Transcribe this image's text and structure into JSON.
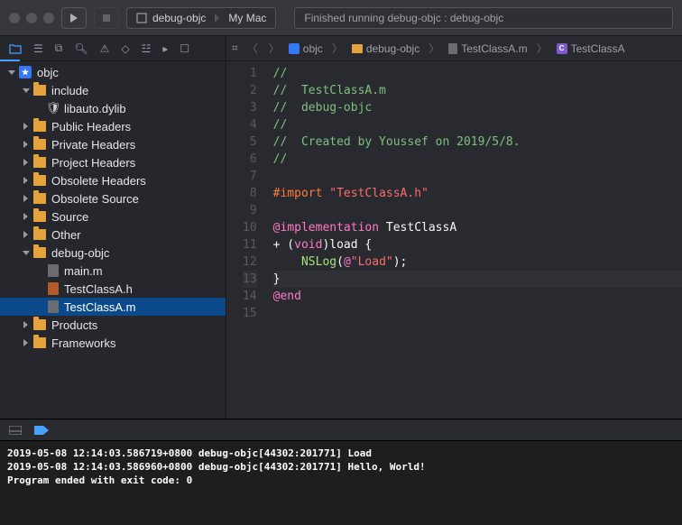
{
  "titlebar": {
    "scheme": "debug-objc",
    "destination": "My Mac",
    "activity": "Finished running debug-objc : debug-objc"
  },
  "navigator": {
    "project": "objc",
    "groups": [
      {
        "label": "include",
        "depth": 1,
        "open": true,
        "children": [
          {
            "label": "libauto.dylib",
            "type": "shield"
          }
        ]
      },
      {
        "label": "Public Headers",
        "depth": 1,
        "open": false
      },
      {
        "label": "Private Headers",
        "depth": 1,
        "open": false
      },
      {
        "label": "Project Headers",
        "depth": 1,
        "open": false
      },
      {
        "label": "Obsolete Headers",
        "depth": 1,
        "open": false
      },
      {
        "label": "Obsolete Source",
        "depth": 1,
        "open": false
      },
      {
        "label": "Source",
        "depth": 1,
        "open": false
      },
      {
        "label": "Other",
        "depth": 1,
        "open": false
      },
      {
        "label": "debug-objc",
        "depth": 1,
        "open": true,
        "children": [
          {
            "label": "main.m",
            "type": "m"
          },
          {
            "label": "TestClassA.h",
            "type": "h"
          },
          {
            "label": "TestClassA.m",
            "type": "m",
            "selected": true
          }
        ]
      },
      {
        "label": "Products",
        "depth": 1,
        "open": false
      },
      {
        "label": "Frameworks",
        "depth": 1,
        "open": false
      }
    ]
  },
  "jumpbar": {
    "crumbs": [
      "objc",
      "debug-objc",
      "TestClassA.m",
      "TestClassA"
    ]
  },
  "source": {
    "lines": [
      {
        "n": 1,
        "t": "//",
        "cls": "c-comment"
      },
      {
        "n": 2,
        "t": "//  TestClassA.m",
        "cls": "c-comment"
      },
      {
        "n": 3,
        "t": "//  debug-objc",
        "cls": "c-comment"
      },
      {
        "n": 4,
        "t": "//",
        "cls": "c-comment"
      },
      {
        "n": 5,
        "t": "//  Created by Youssef on 2019/5/8.",
        "cls": "c-comment"
      },
      {
        "n": 6,
        "t": "//",
        "cls": "c-comment"
      },
      {
        "n": 7,
        "t": "",
        "cls": ""
      },
      {
        "n": 8,
        "html": "<span class='c-pre'>#import </span><span class='c-str'>\"TestClassA.h\"</span>"
      },
      {
        "n": 9,
        "t": "",
        "cls": ""
      },
      {
        "n": 10,
        "html": "<span class='c-key'>@implementation</span> <span class='c-ident'>TestClassA</span>"
      },
      {
        "n": 11,
        "html": "<span class='c-ident'>+ (</span><span class='c-key'>void</span><span class='c-ident'>)load {</span>"
      },
      {
        "n": 12,
        "html": "    <span class='c-func'>NSLog</span><span class='c-ident'>(</span><span class='c-at'>@</span><span class='c-str'>\"Load\"</span><span class='c-ident'>);</span>"
      },
      {
        "n": 13,
        "t": "}",
        "cls": "c-ident",
        "hl": true
      },
      {
        "n": 14,
        "html": "<span class='c-key'>@end</span>"
      },
      {
        "n": 15,
        "t": "",
        "cls": ""
      }
    ]
  },
  "console": {
    "lines": [
      "2019-05-08 12:14:03.586719+0800 debug-objc[44302:201771] Load",
      "2019-05-08 12:14:03.586960+0800 debug-objc[44302:201771] Hello, World!",
      "Program ended with exit code: 0"
    ]
  }
}
